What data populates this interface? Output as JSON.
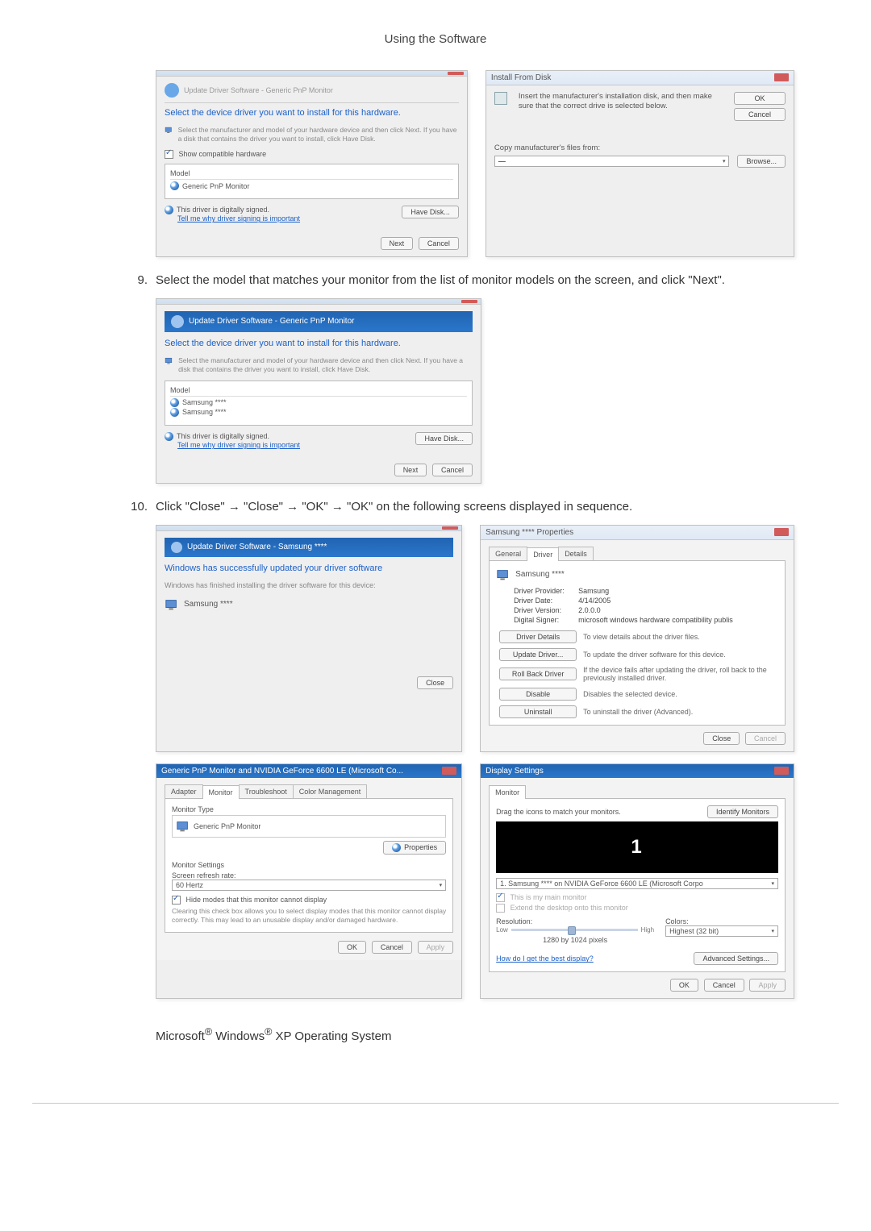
{
  "header": {
    "title": "Using the Software"
  },
  "steps": {
    "nine": {
      "num": "9.",
      "text": "Select the model that matches your monitor from the list of monitor models on the screen, and click \"Next\"."
    },
    "ten": {
      "num": "10.",
      "text": "Click \"Close\" → \"Close\" → \"OK\" → \"OK\" on the following screens displayed in sequence."
    }
  },
  "dlg1": {
    "crumb": "Update Driver Software - Generic PnP Monitor",
    "heading": "Select the device driver you want to install for this hardware.",
    "sub": "Select the manufacturer and model of your hardware device and then click Next. If you have a disk that contains the driver you want to install, click Have Disk.",
    "showCompat": "Show compatible hardware",
    "modelLabel": "Model",
    "modelItem": "Generic PnP Monitor",
    "signed": "This driver is digitally signed.",
    "tell": "Tell me why driver signing is important",
    "haveDisk": "Have Disk...",
    "next": "Next",
    "cancel": "Cancel"
  },
  "dlg2": {
    "title": "Install From Disk",
    "msg": "Insert the manufacturer's installation disk, and then make sure that the correct drive is selected below.",
    "ok": "OK",
    "cancel": "Cancel",
    "copyFrom": "Copy manufacturer's files from:",
    "browse": "Browse..."
  },
  "dlg3": {
    "crumb": "Update Driver Software - Generic PnP Monitor",
    "heading": "Select the device driver you want to install for this hardware.",
    "sub": "Select the manufacturer and model of your hardware device and then click Next. If you have a disk that contains the driver you want to install, click Have Disk.",
    "modelLabel": "Model",
    "modelItem1": "Samsung ****",
    "modelItem2": "Samsung ****",
    "signed": "This driver is digitally signed.",
    "tell": "Tell me why driver signing is important",
    "haveDisk": "Have Disk...",
    "next": "Next",
    "cancel": "Cancel"
  },
  "dlg4": {
    "crumb": "Update Driver Software - Samsung ****",
    "heading": "Windows has successfully updated your driver software",
    "sub": "Windows has finished installing the driver software for this device:",
    "device": "Samsung ****",
    "close": "Close"
  },
  "dlg5": {
    "title": "Samsung **** Properties",
    "tabs": {
      "general": "General",
      "driver": "Driver",
      "details": "Details"
    },
    "device": "Samsung ****",
    "provider": {
      "k": "Driver Provider:",
      "v": "Samsung"
    },
    "date": {
      "k": "Driver Date:",
      "v": "4/14/2005"
    },
    "version": {
      "k": "Driver Version:",
      "v": "2.0.0.0"
    },
    "signer": {
      "k": "Digital Signer:",
      "v": "microsoft windows hardware compatibility publis"
    },
    "btnDetails": "Driver Details",
    "descDetails": "To view details about the driver files.",
    "btnUpdate": "Update Driver...",
    "descUpdate": "To update the driver software for this device.",
    "btnRoll": "Roll Back Driver",
    "descRoll": "If the device fails after updating the driver, roll back to the previously installed driver.",
    "btnDisable": "Disable",
    "descDisable": "Disables the selected device.",
    "btnUninstall": "Uninstall",
    "descUninstall": "To uninstall the driver (Advanced).",
    "close": "Close",
    "cancel": "Cancel"
  },
  "dlg6": {
    "title": "Generic PnP Monitor and NVIDIA GeForce 6600 LE (Microsoft Co...",
    "tabs": {
      "adapter": "Adapter",
      "monitor": "Monitor",
      "troubleshoot": "Troubleshoot",
      "color": "Color Management"
    },
    "typeLabel": "Monitor Type",
    "typeValue": "Generic PnP Monitor",
    "properties": "Properties",
    "settingsLabel": "Monitor Settings",
    "refreshLabel": "Screen refresh rate:",
    "refreshValue": "60 Hertz",
    "hideModes": "Hide modes that this monitor cannot display",
    "hideNote": "Clearing this check box allows you to select display modes that this monitor cannot display correctly. This may lead to an unusable display and/or damaged hardware.",
    "ok": "OK",
    "cancel": "Cancel",
    "apply": "Apply"
  },
  "dlg7": {
    "title": "Display Settings",
    "tab": "Monitor",
    "drag": "Drag the icons to match your monitors.",
    "identify": "Identify Monitors",
    "monLabel": "1",
    "adapter": "1. Samsung **** on NVIDIA GeForce 6600 LE (Microsoft Corpo",
    "main": "This is my main monitor",
    "extend": "Extend the desktop onto this monitor",
    "resolution": "Resolution:",
    "low": "Low",
    "high": "High",
    "resValue": "1280 by 1024 pixels",
    "colorsLabel": "Colors:",
    "colorsValue": "Highest (32 bit)",
    "best": "How do I get the best display?",
    "advanced": "Advanced Settings...",
    "ok": "OK",
    "cancel": "Cancel",
    "apply": "Apply"
  },
  "footnote": {
    "prefix": "Microsoft",
    "reg1": "®",
    "mid": " Windows",
    "reg2": "®",
    "suffix": " XP Operating System"
  }
}
